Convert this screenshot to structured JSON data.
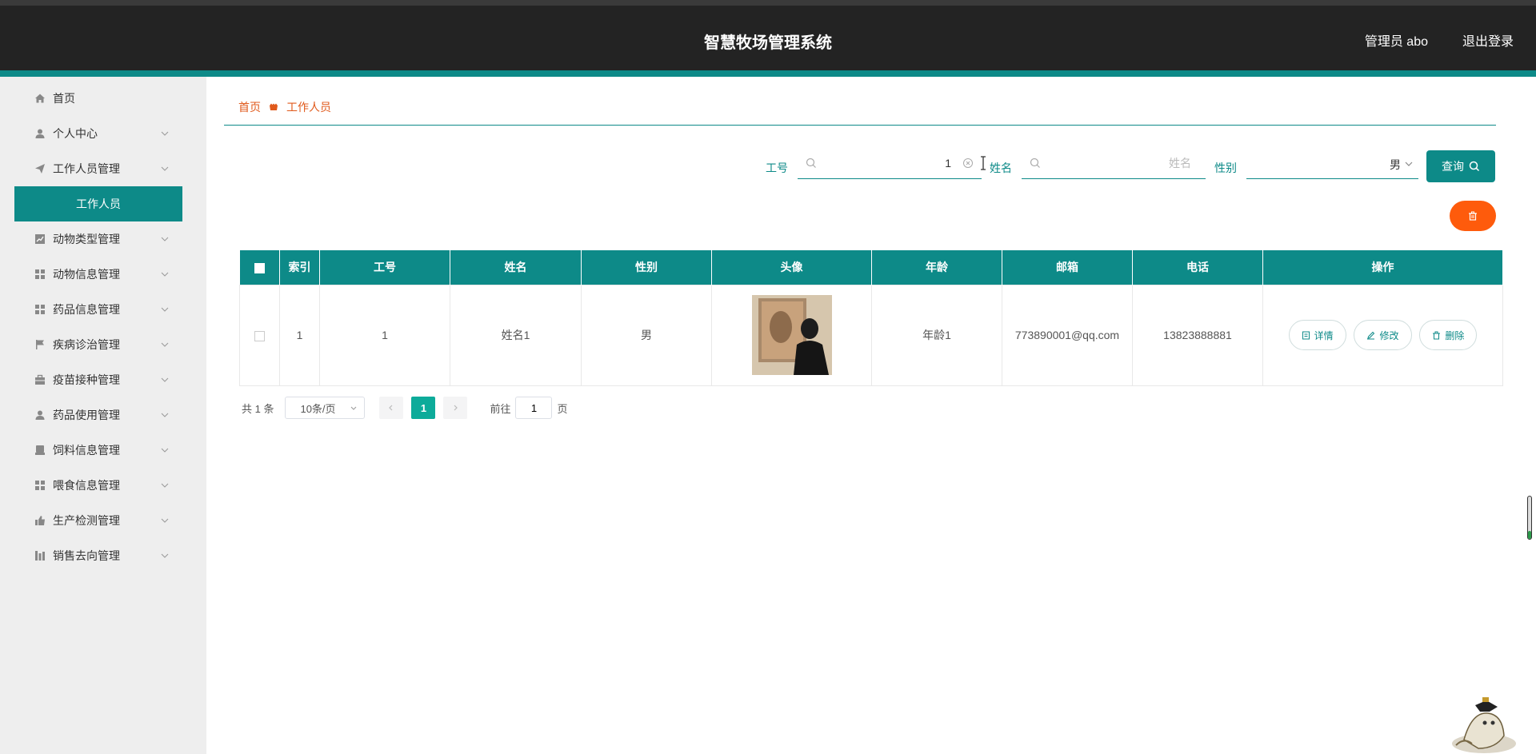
{
  "app": {
    "title": "智慧牧场管理系统",
    "user_label": "管理员 abo",
    "logout_label": "退出登录"
  },
  "sidebar": {
    "items": [
      {
        "label": "首页",
        "icon": "home-icon"
      },
      {
        "label": "个人中心",
        "icon": "user-icon"
      },
      {
        "label": "工作人员管理",
        "icon": "send-icon"
      },
      {
        "label": "动物类型管理",
        "icon": "chart-icon"
      },
      {
        "label": "动物信息管理",
        "icon": "grid-icon"
      },
      {
        "label": "药品信息管理",
        "icon": "grid-icon"
      },
      {
        "label": "疾病诊治管理",
        "icon": "flag-icon"
      },
      {
        "label": "疫苗接种管理",
        "icon": "briefcase-icon"
      },
      {
        "label": "药品使用管理",
        "icon": "user-icon"
      },
      {
        "label": "饲料信息管理",
        "icon": "printer-icon"
      },
      {
        "label": "喂食信息管理",
        "icon": "grid-icon"
      },
      {
        "label": "生产检测管理",
        "icon": "thumb-icon"
      },
      {
        "label": "销售去向管理",
        "icon": "bar-chart-icon"
      }
    ],
    "active_sub": "工作人员"
  },
  "breadcrumb": {
    "home": "首页",
    "current": "工作人员"
  },
  "search": {
    "gonghao_label": "工号",
    "gonghao_value": "1",
    "name_label": "姓名",
    "name_placeholder": "姓名",
    "gender_label": "性别",
    "gender_value": "男",
    "query_label": "查询"
  },
  "table": {
    "headers": [
      "索引",
      "工号",
      "姓名",
      "性别",
      "头像",
      "年龄",
      "邮箱",
      "电话",
      "操作"
    ],
    "rows": [
      {
        "index": "1",
        "gonghao": "1",
        "name": "姓名1",
        "gender": "男",
        "age": "年龄1",
        "email": "773890001@qq.com",
        "phone": "13823888881"
      }
    ],
    "actions": {
      "detail": "详情",
      "edit": "修改",
      "delete": "删除"
    }
  },
  "pager": {
    "total": "共 1 条",
    "page_size": "10条/页",
    "current_page": "1",
    "goto_label": "前往",
    "goto_value": "1",
    "page_suffix": "页"
  },
  "colors": {
    "primary": "#0d8a88",
    "accent": "#fe5b0c",
    "header_bg": "#232323"
  }
}
